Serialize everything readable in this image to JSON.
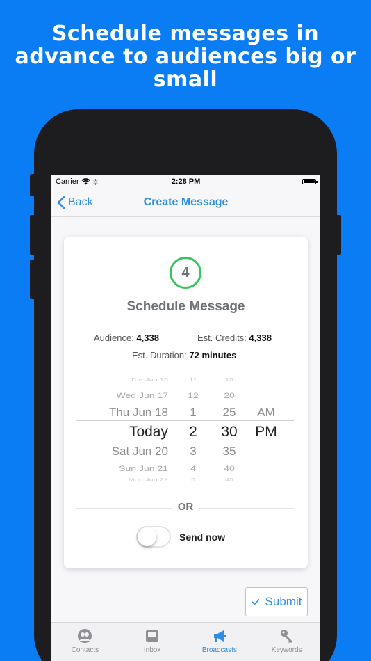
{
  "headline": "Schedule messages in advance to audiences big or small",
  "status": {
    "carrier": "Carrier",
    "time": "2:28 PM"
  },
  "nav": {
    "back_label": "Back",
    "title": "Create Message"
  },
  "card": {
    "step_number": "4",
    "title": "Schedule Message",
    "audience_label": "Audience:",
    "audience_value": "4,338",
    "credits_label": "Est. Credits:",
    "credits_value": "4,338",
    "duration_label": "Est. Duration:",
    "duration_value": "72 minutes"
  },
  "picker": {
    "days": [
      "Tue Jun 16",
      "Wed Jun 17",
      "Thu Jun 18",
      "Today",
      "Sat Jun 20",
      "Sun Jun 21",
      "Mon Jun 22"
    ],
    "hours": [
      "11",
      "12",
      "1",
      "2",
      "3",
      "4",
      "5"
    ],
    "minutes": [
      "15",
      "20",
      "25",
      "30",
      "35",
      "40",
      "45"
    ],
    "ampm": [
      "AM",
      "PM"
    ],
    "selected": {
      "day": "Today",
      "hour": "2",
      "minute": "30",
      "ampm": "PM"
    }
  },
  "or_label": "OR",
  "send_now": {
    "label": "Send now",
    "on": false
  },
  "submit_label": "Submit",
  "tabs": [
    {
      "label": "Contacts",
      "icon": "contacts-icon",
      "active": false
    },
    {
      "label": "Inbox",
      "icon": "inbox-icon",
      "active": false
    },
    {
      "label": "Broadcasts",
      "icon": "megaphone-icon",
      "active": true
    },
    {
      "label": "Keywords",
      "icon": "key-icon",
      "active": false
    }
  ],
  "colors": {
    "background": "#0a7cf4",
    "accent": "#2f8ee0",
    "step_ring": "#37c65a"
  }
}
